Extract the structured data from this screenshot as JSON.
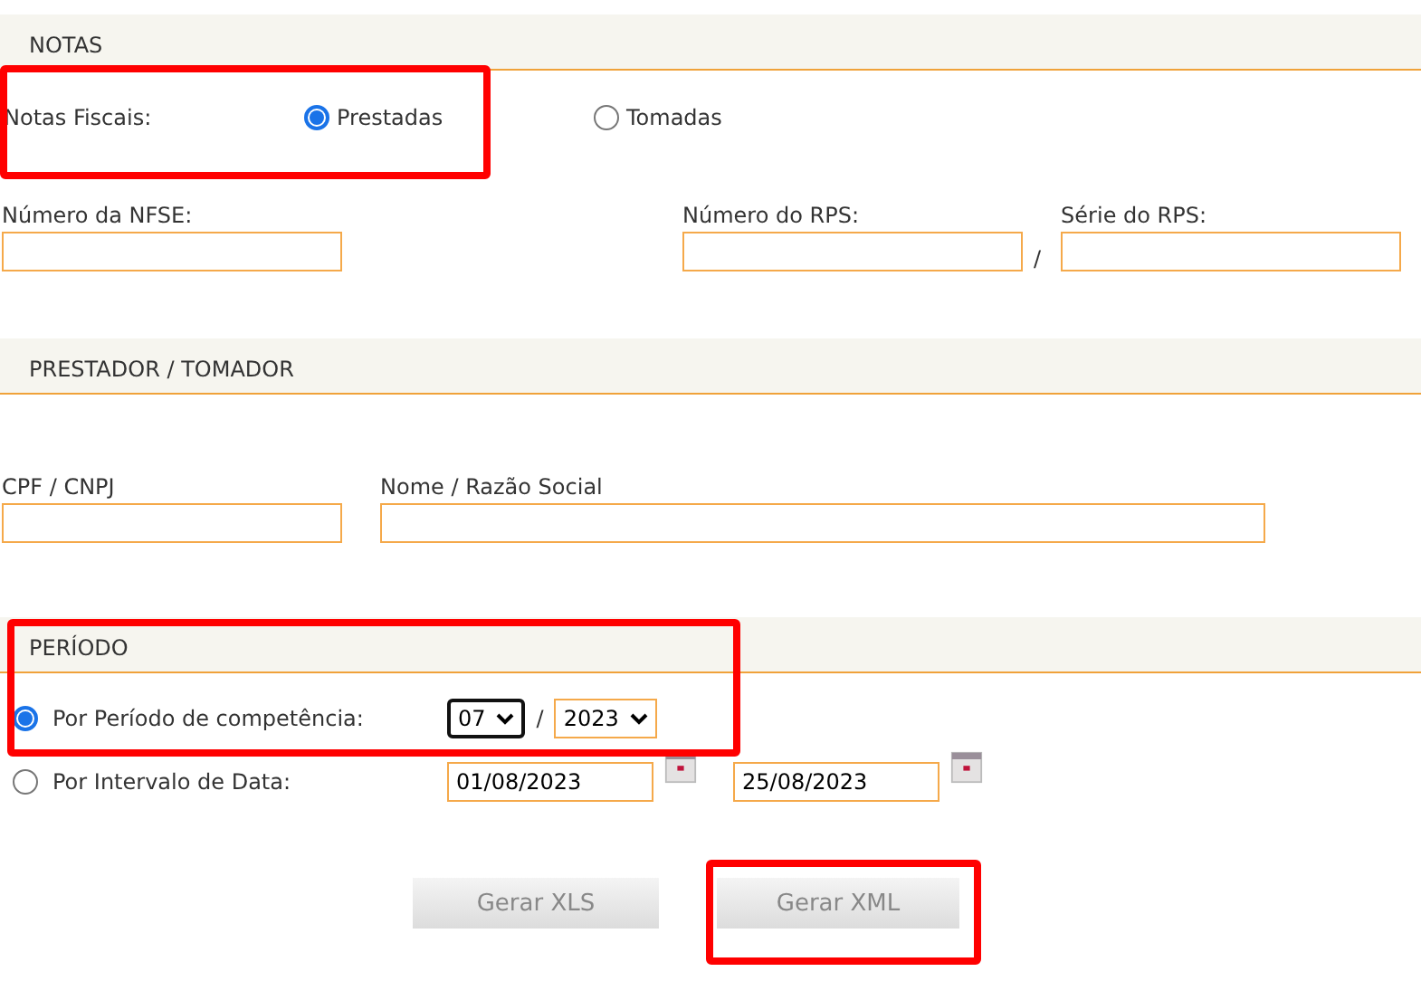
{
  "notas": {
    "title": "NOTAS",
    "highlighted": true,
    "label": "Notas Fiscais:",
    "options": [
      {
        "label": "Prestadas",
        "selected": true
      },
      {
        "label": "Tomadas",
        "selected": false
      }
    ],
    "nfse_label": "Número da NFSE:",
    "rps_label": "Número do RPS:",
    "separator": "/",
    "serie_label": "Série do RPS:"
  },
  "prestador": {
    "title": "PRESTADOR / TOMADOR",
    "cpf_label": "CPF / CNPJ",
    "nome_label": "Nome / Razão Social"
  },
  "periodo": {
    "title": "PERÍODO",
    "highlighted": true,
    "options": [
      {
        "label": "Por Período de competência:",
        "selected": true,
        "month": "07",
        "separator": "/",
        "year": "2023"
      },
      {
        "label": "Por Intervalo de Data:",
        "selected": false,
        "start": "01/08/2023",
        "end": "25/08/2023"
      }
    ]
  },
  "buttons": [
    {
      "label": "Gerar XLS",
      "highlighted": false
    },
    {
      "label": "Gerar XML",
      "highlighted": true
    }
  ]
}
